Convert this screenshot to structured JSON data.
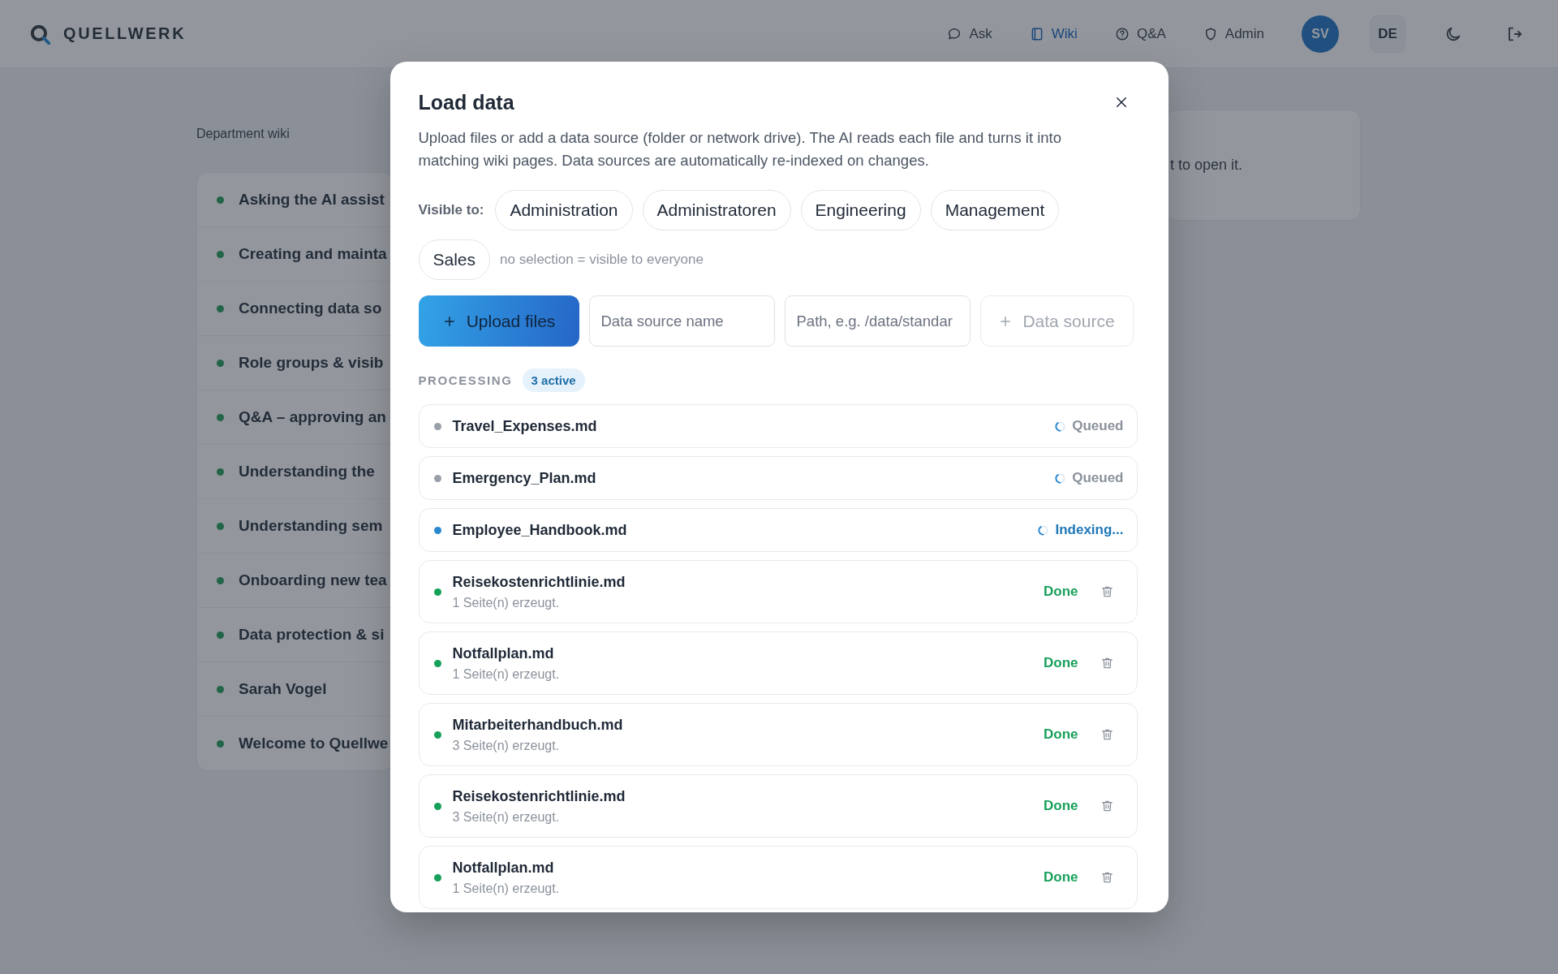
{
  "header": {
    "brand": "QUELLWERK",
    "nav": [
      {
        "label": "Ask",
        "selected": false
      },
      {
        "label": "Wiki",
        "selected": true
      },
      {
        "label": "Q&A",
        "selected": false
      },
      {
        "label": "Admin",
        "selected": false
      }
    ],
    "avatar": "SV",
    "language": "DE"
  },
  "wiki": {
    "label": "Department wiki",
    "pages": [
      "Asking the AI assist",
      "Creating and mainta",
      "Connecting data so",
      "Role groups & visib",
      "Q&A – approving an",
      "Understanding the",
      "Understanding sem",
      "Onboarding new tea",
      "Data protection & si",
      "Sarah Vogel",
      "Welcome to Quellwe"
    ]
  },
  "content_card": {
    "text": "t to open it."
  },
  "modal": {
    "title": "Load data",
    "description": "Upload files or add a data source (folder or network drive). The AI reads each file and turns it into matching wiki pages. Data sources are automatically re-indexed on changes.",
    "visibility": {
      "label": "Visible to:",
      "groups": [
        {
          "label": "Administration",
          "selected": false
        },
        {
          "label": "Administratoren",
          "selected": false
        },
        {
          "label": "Engineering",
          "selected": false
        },
        {
          "label": "Management",
          "selected": false
        },
        {
          "label": "Sales",
          "selected": false
        }
      ],
      "hint": "no selection = visible to everyone"
    },
    "upload_button": "Upload files",
    "source_name": {
      "placeholder": "Data source name"
    },
    "source_path": {
      "placeholder": "Path, e.g. /data/standar"
    },
    "add_source": {
      "label": "Data source",
      "disabled": true
    },
    "processing": {
      "title": "PROCESSING",
      "badge": "3 active",
      "items": [
        {
          "name": "Travel_Expenses.md",
          "kind": "queued",
          "status": "Queued"
        },
        {
          "name": "Emergency_Plan.md",
          "kind": "queued",
          "status": "Queued"
        },
        {
          "name": "Employee_Handbook.md",
          "kind": "indexing",
          "status": "Indexing..."
        },
        {
          "name": "Reisekostenrichtlinie.md",
          "kind": "done",
          "status": "Done",
          "detail": "1 Seite(n) erzeugt."
        },
        {
          "name": "Notfallplan.md",
          "kind": "done",
          "status": "Done",
          "detail": "1 Seite(n) erzeugt."
        },
        {
          "name": "Mitarbeiterhandbuch.md",
          "kind": "done",
          "status": "Done",
          "detail": "3 Seite(n) erzeugt."
        },
        {
          "name": "Reisekostenrichtlinie.md",
          "kind": "done",
          "status": "Done",
          "detail": "3 Seite(n) erzeugt."
        },
        {
          "name": "Notfallplan.md",
          "kind": "done",
          "status": "Done",
          "detail": "1 Seite(n) erzeugt."
        }
      ]
    }
  }
}
